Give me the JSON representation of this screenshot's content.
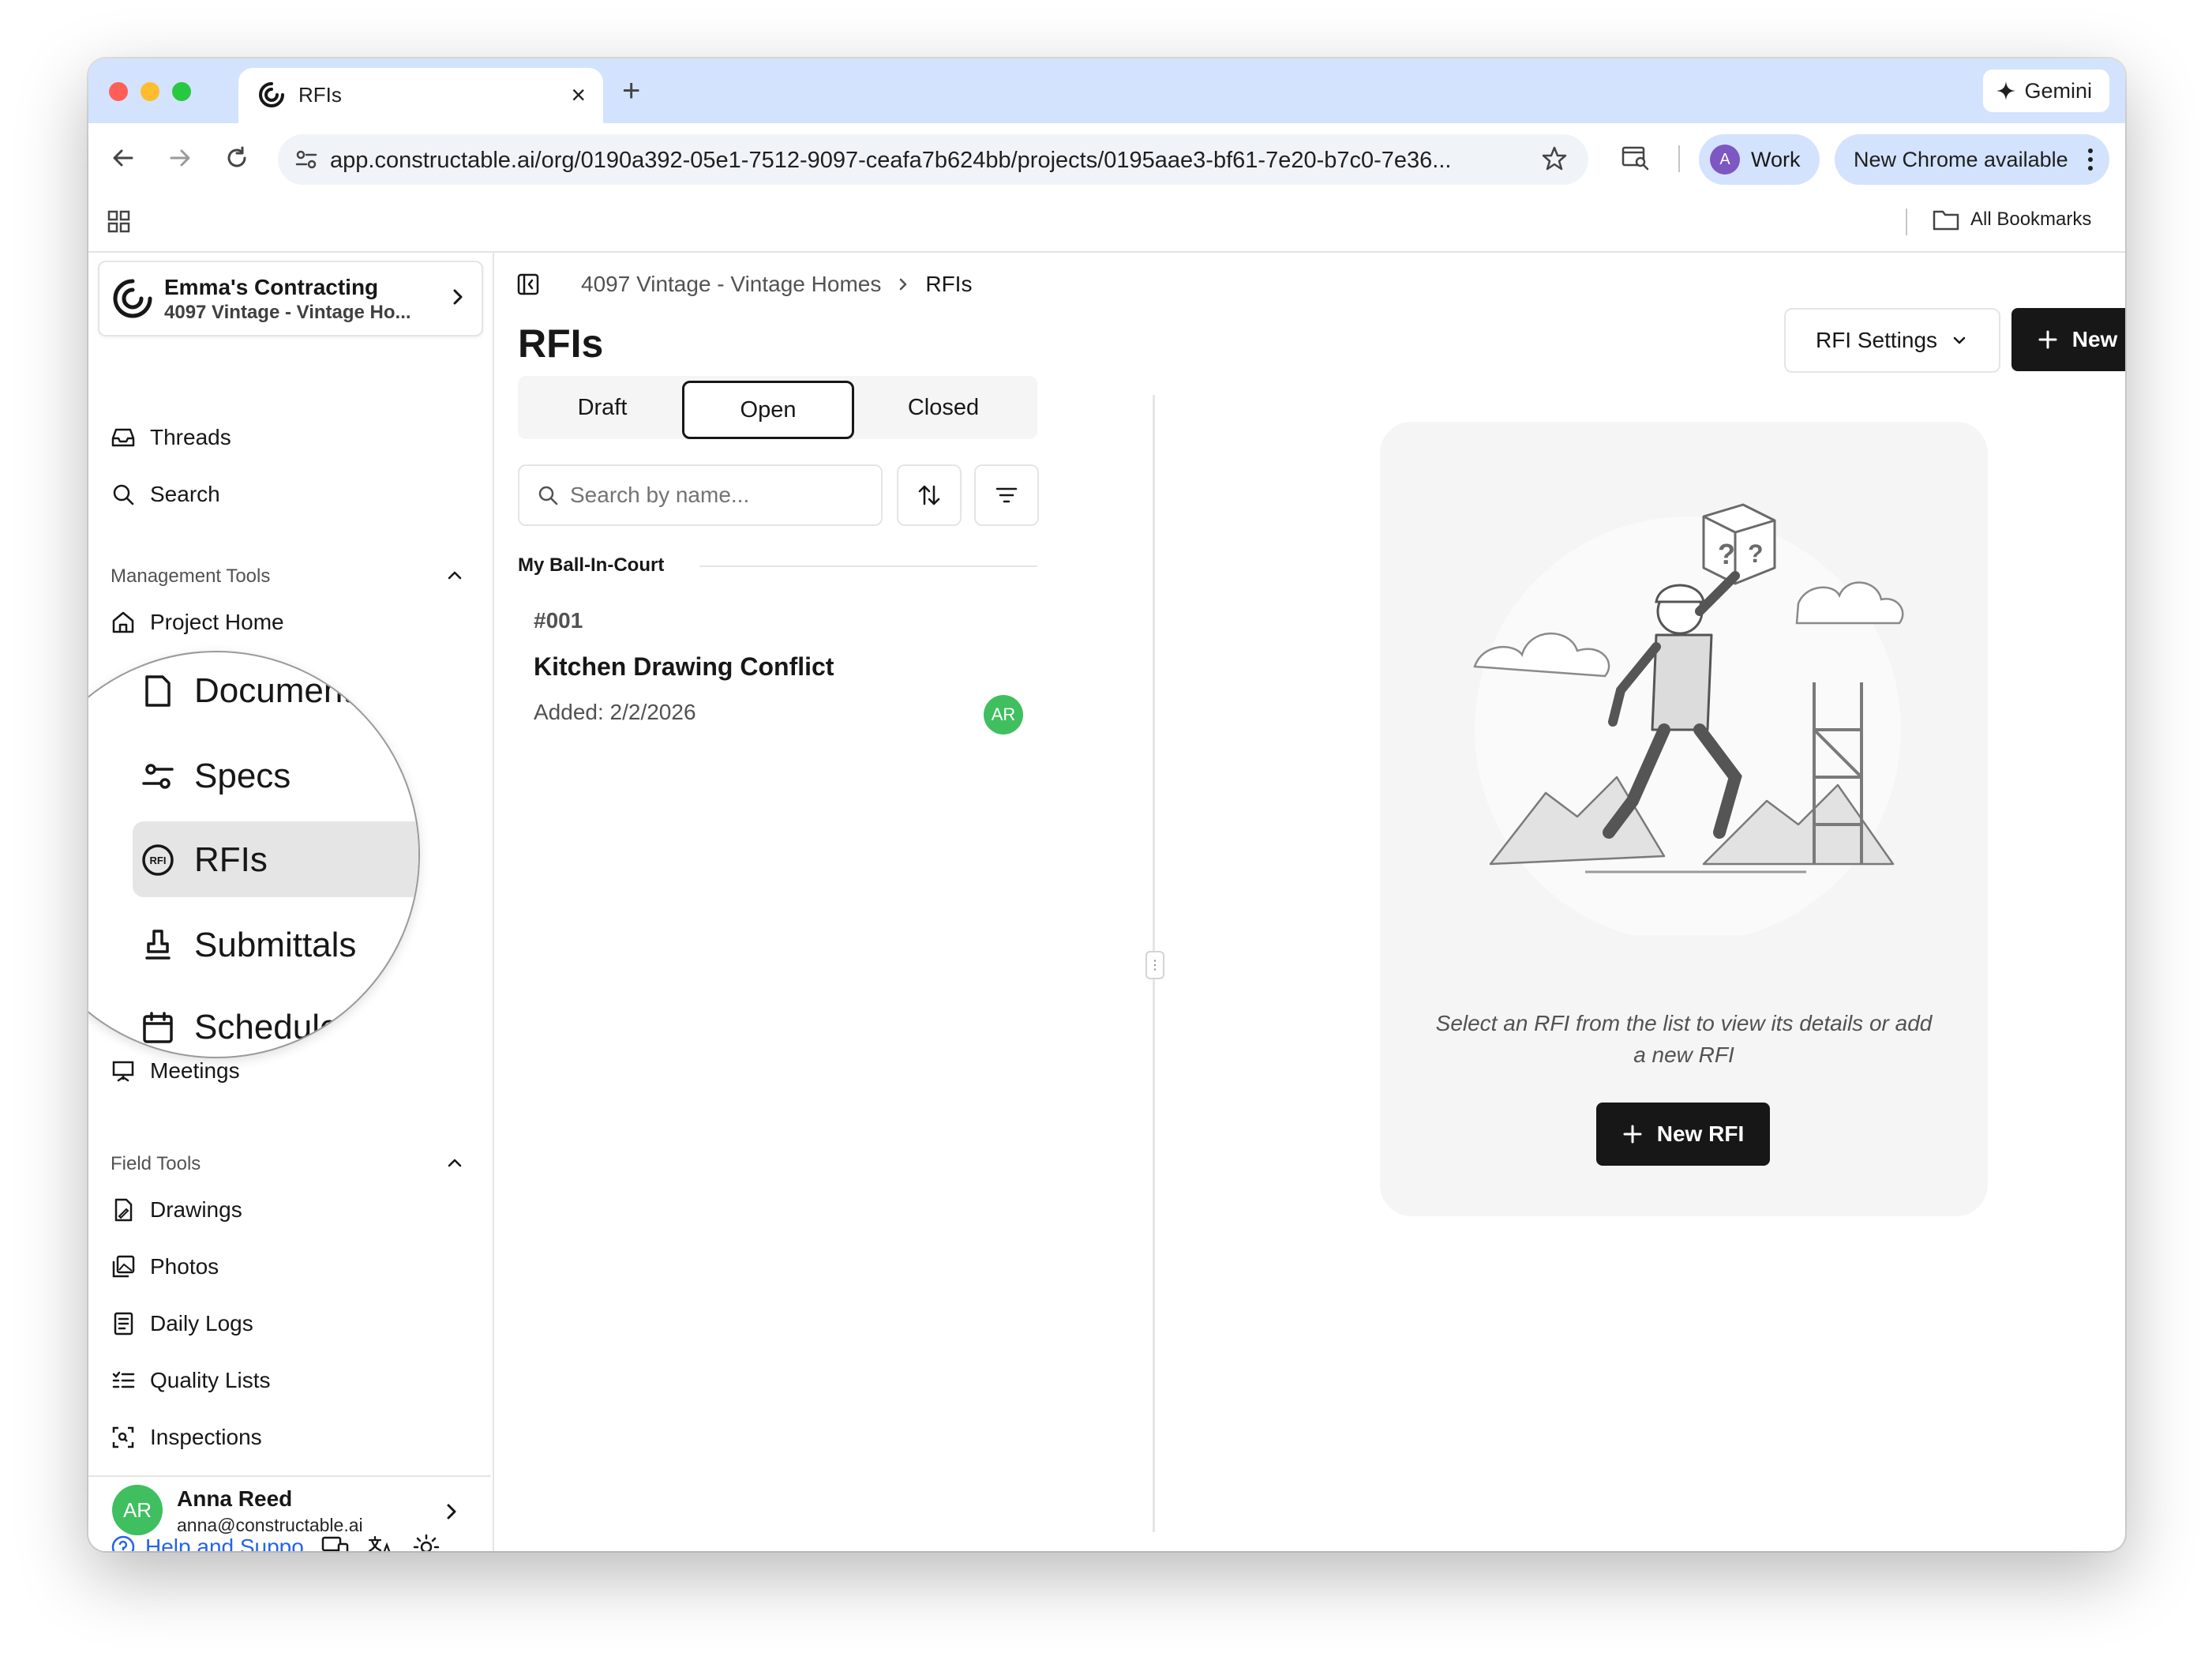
{
  "browser": {
    "tab_title": "RFIs",
    "new_tab": "+",
    "close_tab": "×",
    "gemini_label": "Gemini",
    "url": "app.constructable.ai/org/0190a392-05e1-7512-9097-ceafa7b624bb/projects/0195aae3-bf61-7e20-b7c0-7e36...",
    "profile_initial": "A",
    "profile_label": "Work",
    "update_label": "New Chrome available",
    "bookmarks_label": "All Bookmarks"
  },
  "sidebar": {
    "org_name": "Emma's Contracting",
    "project_name": "4097 Vintage - Vintage Ho...",
    "top_items": [
      {
        "label": "Threads",
        "icon": "inbox-icon"
      },
      {
        "label": "Search",
        "icon": "search-icon"
      }
    ],
    "management_label": "Management Tools",
    "management_items": [
      {
        "label": "Project Home",
        "icon": "home-icon"
      },
      {
        "label": "Meetings",
        "icon": "presentation-icon"
      }
    ],
    "zoom_items": [
      {
        "label": "Documents",
        "icon": "document-icon"
      },
      {
        "label": "Specs",
        "icon": "sliders-icon"
      },
      {
        "label": "RFIs",
        "icon": "rfi-icon",
        "active": true
      },
      {
        "label": "Submittals",
        "icon": "stamp-icon"
      },
      {
        "label": "Schedule",
        "icon": "calendar-icon"
      }
    ],
    "field_label": "Field Tools",
    "field_items": [
      {
        "label": "Drawings",
        "icon": "drawing-icon"
      },
      {
        "label": "Photos",
        "icon": "photos-icon"
      },
      {
        "label": "Daily Logs",
        "icon": "log-icon"
      },
      {
        "label": "Quality Lists",
        "icon": "checklist-icon"
      },
      {
        "label": "Inspections",
        "icon": "inspect-icon"
      }
    ],
    "user": {
      "initials": "AR",
      "name": "Anna Reed",
      "email": "anna@constructable.ai"
    },
    "help_label": "Help and Suppo"
  },
  "main": {
    "breadcrumb": [
      "4097 Vintage - Vintage Homes",
      "RFIs"
    ],
    "title": "RFIs",
    "settings_label": "RFI Settings",
    "new_rfi_label": "New RFI",
    "tabs": [
      {
        "label": "Draft",
        "active": false
      },
      {
        "label": "Open",
        "active": true
      },
      {
        "label": "Closed",
        "active": false
      }
    ],
    "search_placeholder": "Search by name...",
    "group_label": "My Ball-In-Court",
    "rfis": [
      {
        "number": "#001",
        "title": "Kitchen Drawing Conflict",
        "added": "Added: 2/2/2026",
        "assignee": "AR"
      }
    ],
    "empty_state_text": "Select an RFI from the list to view its details or add a new RFI",
    "empty_new_label": "New RFI"
  },
  "colors": {
    "accent": "#171717",
    "tabstrip": "#d3e3fd",
    "avatar": "#3fbf5f",
    "link": "#2563eb"
  }
}
